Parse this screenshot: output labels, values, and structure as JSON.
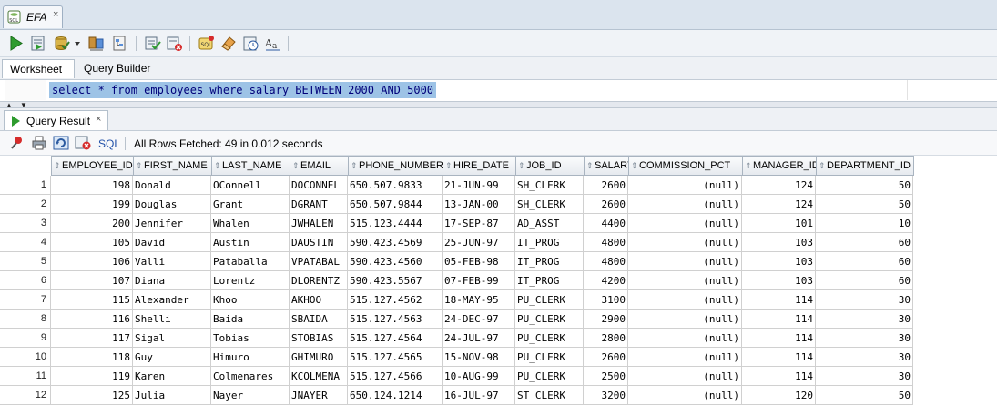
{
  "document_tab": {
    "title": "EFA",
    "close": "×"
  },
  "worksheet_tabs": [
    "Worksheet",
    "Query Builder"
  ],
  "editor": {
    "sql": "select * from employees where salary BETWEEN 2000 AND 5000"
  },
  "result_tab": {
    "label": "Query Result",
    "close": "×"
  },
  "result_toolbar": {
    "sql_link": "SQL",
    "status": "All Rows Fetched: 49 in 0.012 seconds"
  },
  "toolbar_icons": [
    "run-statement-icon",
    "run-script-icon",
    "commit-icon",
    "dropdown-arrow-icon",
    "autotrace-icon",
    "explain-plan-icon",
    "sql-tuning-icon",
    "clear-icon",
    "unshared-sql-icon",
    "eraser-icon",
    "sql-history-icon",
    "format-text-icon"
  ],
  "columns": [
    "EMPLOYEE_ID",
    "FIRST_NAME",
    "LAST_NAME",
    "EMAIL",
    "PHONE_NUMBER",
    "HIRE_DATE",
    "JOB_ID",
    "SALARY",
    "COMMISSION_PCT",
    "MANAGER_ID",
    "DEPARTMENT_ID"
  ],
  "rows": [
    [
      "1",
      "198",
      "Donald",
      "OConnell",
      "DOCONNEL",
      "650.507.9833",
      "21-JUN-99",
      "SH_CLERK",
      "2600",
      "(null)",
      "124",
      "50"
    ],
    [
      "2",
      "199",
      "Douglas",
      "Grant",
      "DGRANT",
      "650.507.9844",
      "13-JAN-00",
      "SH_CLERK",
      "2600",
      "(null)",
      "124",
      "50"
    ],
    [
      "3",
      "200",
      "Jennifer",
      "Whalen",
      "JWHALEN",
      "515.123.4444",
      "17-SEP-87",
      "AD_ASST",
      "4400",
      "(null)",
      "101",
      "10"
    ],
    [
      "4",
      "105",
      "David",
      "Austin",
      "DAUSTIN",
      "590.423.4569",
      "25-JUN-97",
      "IT_PROG",
      "4800",
      "(null)",
      "103",
      "60"
    ],
    [
      "5",
      "106",
      "Valli",
      "Pataballa",
      "VPATABAL",
      "590.423.4560",
      "05-FEB-98",
      "IT_PROG",
      "4800",
      "(null)",
      "103",
      "60"
    ],
    [
      "6",
      "107",
      "Diana",
      "Lorentz",
      "DLORENTZ",
      "590.423.5567",
      "07-FEB-99",
      "IT_PROG",
      "4200",
      "(null)",
      "103",
      "60"
    ],
    [
      "7",
      "115",
      "Alexander",
      "Khoo",
      "AKHOO",
      "515.127.4562",
      "18-MAY-95",
      "PU_CLERK",
      "3100",
      "(null)",
      "114",
      "30"
    ],
    [
      "8",
      "116",
      "Shelli",
      "Baida",
      "SBAIDA",
      "515.127.4563",
      "24-DEC-97",
      "PU_CLERK",
      "2900",
      "(null)",
      "114",
      "30"
    ],
    [
      "9",
      "117",
      "Sigal",
      "Tobias",
      "STOBIAS",
      "515.127.4564",
      "24-JUL-97",
      "PU_CLERK",
      "2800",
      "(null)",
      "114",
      "30"
    ],
    [
      "10",
      "118",
      "Guy",
      "Himuro",
      "GHIMURO",
      "515.127.4565",
      "15-NOV-98",
      "PU_CLERK",
      "2600",
      "(null)",
      "114",
      "30"
    ],
    [
      "11",
      "119",
      "Karen",
      "Colmenares",
      "KCOLMENA",
      "515.127.4566",
      "10-AUG-99",
      "PU_CLERK",
      "2500",
      "(null)",
      "114",
      "30"
    ],
    [
      "12",
      "125",
      "Julia",
      "Nayer",
      "JNAYER",
      "650.124.1214",
      "16-JUL-97",
      "ST_CLERK",
      "3200",
      "(null)",
      "120",
      "50"
    ]
  ]
}
